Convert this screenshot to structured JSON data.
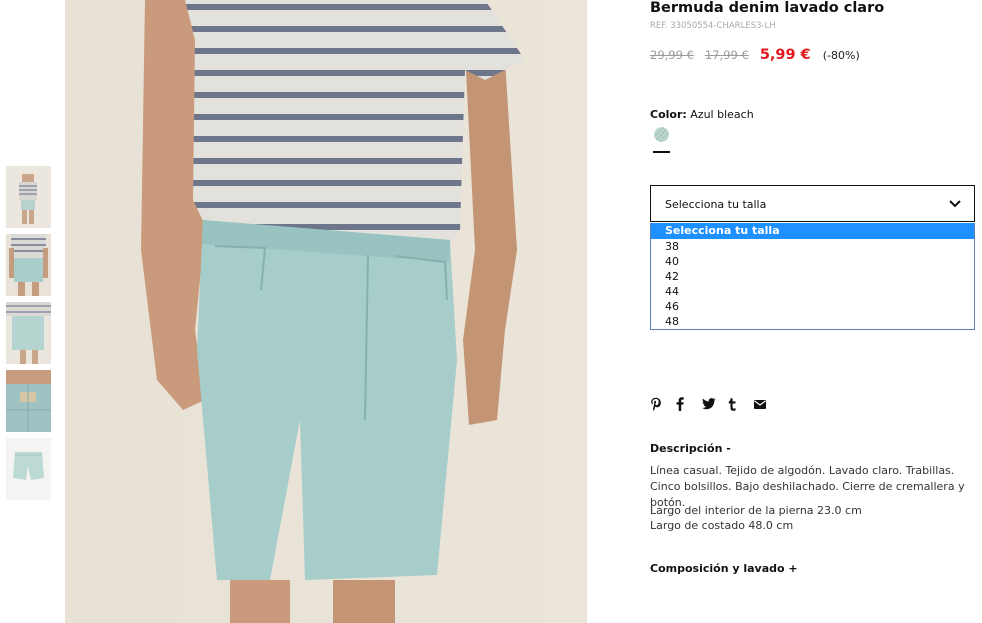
{
  "product": {
    "title": "Bermuda denim lavado claro",
    "ref": "REF. 33050554-CHARLES3-LH",
    "prices": {
      "original": "29,99 €",
      "previous": "17,99 €",
      "sale": "5,99 €",
      "discount": "(-80%)"
    },
    "sale_color": "#e0191f"
  },
  "color": {
    "label": "Color:",
    "value": "Azul bleach",
    "swatch_icon": "color-swatch-azul-bleach"
  },
  "size": {
    "placeholder": "Selecciona tu talla",
    "options": [
      "Selecciona tu talla",
      "38",
      "40",
      "42",
      "44",
      "46",
      "48"
    ],
    "highlight_color": "#1e90ff"
  },
  "social": {
    "icons": [
      "pinterest-icon",
      "facebook-icon",
      "twitter-icon",
      "tumblr-icon",
      "email-icon"
    ]
  },
  "description": {
    "title": "Descripción -",
    "text": "Línea casual. Tejido de algodón. Lavado claro. Trabillas. Cinco bolsillos. Bajo deshilachado. Cierre de cremallera y botón.",
    "measure1": "Largo del interior de la pierna 23.0 cm",
    "measure2": "Largo de costado 48.0 cm"
  },
  "composition": {
    "title": "Composición y lavado +"
  },
  "gallery": {
    "thumb_count": 5
  }
}
